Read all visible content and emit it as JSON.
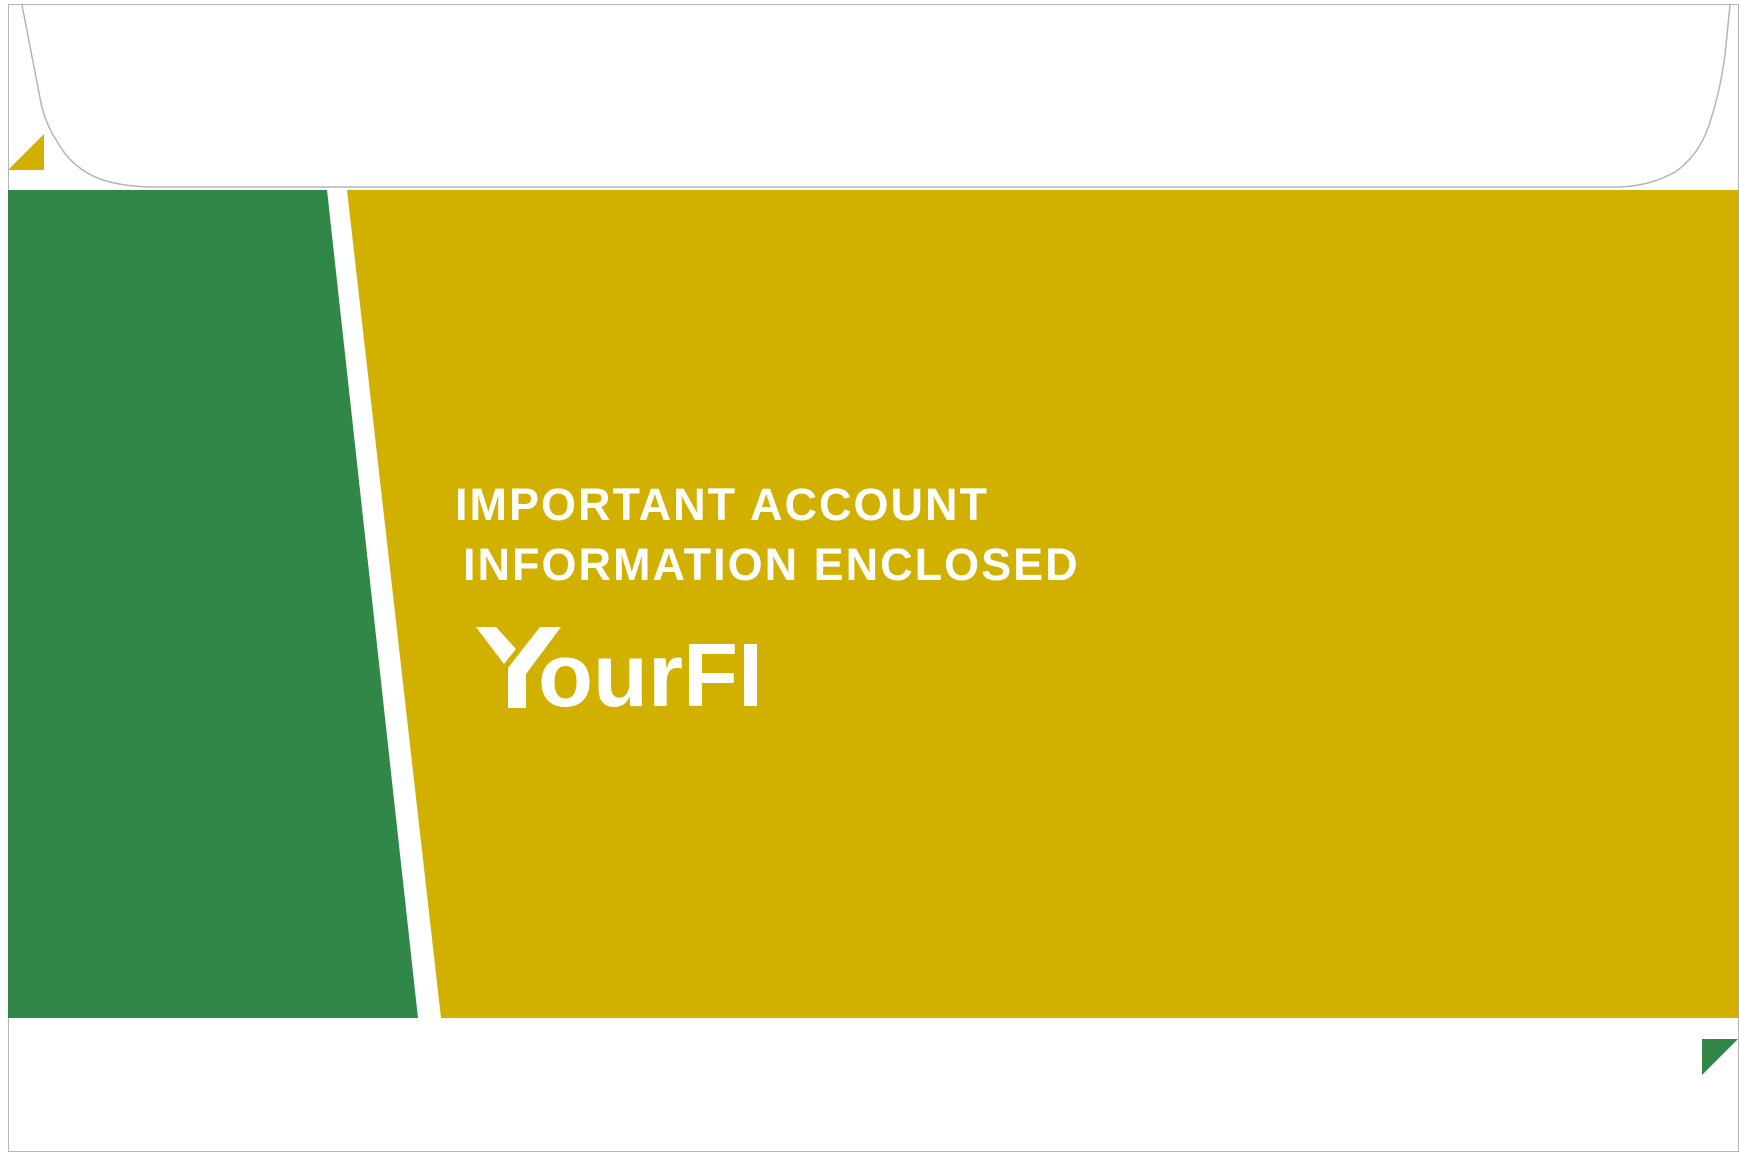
{
  "envelope": {
    "colors": {
      "green": "#318747",
      "gold": "#d1b000",
      "white": "#ffffff",
      "outline": "#b5b5b5"
    },
    "headline": {
      "line1": "IMPORTANT ACCOUNT",
      "line2": "INFORMATION ENCLOSED"
    },
    "brand": {
      "name_prefix": "ourFI",
      "logo_mark": "Y"
    },
    "icons": [
      "corner-triangle-gold-icon",
      "corner-triangle-green-icon"
    ]
  }
}
